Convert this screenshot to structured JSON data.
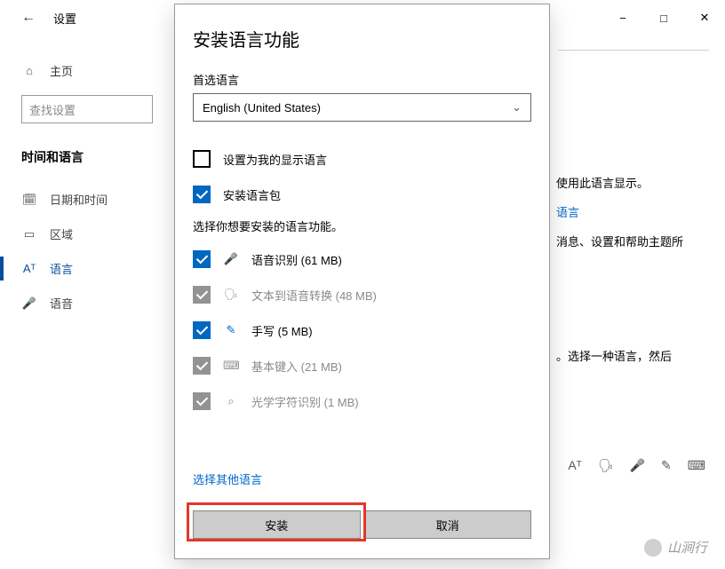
{
  "window": {
    "back_tooltip": "返回",
    "title": "设置"
  },
  "sidebar": {
    "home": "主页",
    "search_placeholder": "查找设置",
    "section": "时间和语言",
    "items": [
      {
        "icon": "🗓",
        "label": "日期和时间"
      },
      {
        "icon": "▭",
        "label": "区域"
      },
      {
        "icon": "Aᵀ",
        "label": "语言"
      },
      {
        "icon": "🎤",
        "label": "语音"
      }
    ]
  },
  "under": {
    "line1": "使用此语言显示。",
    "link1": "语言",
    "line2": "消息、设置和帮助主题所",
    "line3": "。选择一种语言，然后"
  },
  "dialog": {
    "title": "安装语言功能",
    "pref_label": "首选语言",
    "dropdown_value": "English (United States)",
    "opts": [
      {
        "checked": false,
        "disabled": false,
        "icon": "",
        "label": "设置为我的显示语言"
      },
      {
        "checked": true,
        "disabled": false,
        "icon": "",
        "label": "安装语言包"
      }
    ],
    "features_desc": "选择你想要安装的语言功能。",
    "features": [
      {
        "checked": true,
        "disabled": false,
        "icon": "🎤",
        "label": "语音识别 (61 MB)"
      },
      {
        "checked": true,
        "disabled": true,
        "icon": "🗣",
        "label": "文本到语音转换 (48 MB)"
      },
      {
        "checked": true,
        "disabled": false,
        "icon": "✎",
        "label": "手写 (5 MB)"
      },
      {
        "checked": true,
        "disabled": true,
        "icon": "⌨",
        "label": "基本键入 (21 MB)"
      },
      {
        "checked": true,
        "disabled": true,
        "icon": "⌕",
        "label": "光学字符识别 (1 MB)"
      }
    ],
    "other_lang": "选择其他语言",
    "install_btn": "安装",
    "cancel_btn": "取消"
  },
  "watermark": "山涧行"
}
